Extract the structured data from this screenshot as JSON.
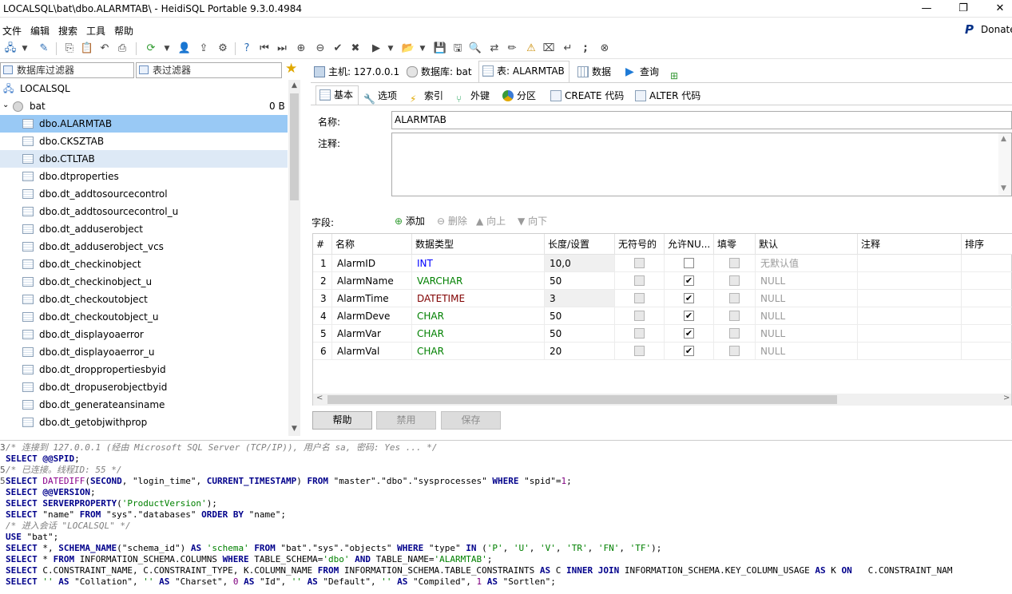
{
  "window": {
    "title": "LOCALSQL\\bat\\dbo.ALARMTAB\\ - HeidiSQL Portable 9.3.0.4984",
    "minimize": "—",
    "maximize": "❐",
    "close": "✕"
  },
  "menu": {
    "items": [
      "文件",
      "编辑",
      "搜索",
      "工具",
      "帮助"
    ],
    "donate": "Donate"
  },
  "filters": {
    "db_filter": "数据库过滤器",
    "table_filter": "表过滤器"
  },
  "tree": {
    "server": "LOCALSQL",
    "database": "bat",
    "db_size": "0 B",
    "tables": [
      "dbo.ALARMTAB",
      "dbo.CKSZTAB",
      "dbo.CTLTAB",
      "dbo.dtproperties",
      "dbo.dt_addtosourcecontrol",
      "dbo.dt_addtosourcecontrol_u",
      "dbo.dt_adduserobject",
      "dbo.dt_adduserobject_vcs",
      "dbo.dt_checkinobject",
      "dbo.dt_checkinobject_u",
      "dbo.dt_checkoutobject",
      "dbo.dt_checkoutobject_u",
      "dbo.dt_displayoaerror",
      "dbo.dt_displayoaerror_u",
      "dbo.dt_droppropertiesbyid",
      "dbo.dt_dropuserobjectbyid",
      "dbo.dt_generateansiname",
      "dbo.dt_getobjwithprop"
    ]
  },
  "tabs": {
    "host": "主机: 127.0.0.1",
    "database": "数据库: bat",
    "table": "表: ALARMTAB",
    "data": "数据",
    "query": "查询"
  },
  "subtabs": {
    "basic": "基本",
    "options": "选项",
    "indexes": "索引",
    "foreign_keys": "外键",
    "partitions": "分区",
    "create_code": "CREATE 代码",
    "alter_code": "ALTER 代码"
  },
  "form": {
    "name_label": "名称:",
    "name_value": "ALARMTAB",
    "comment_label": "注释:",
    "comment_value": ""
  },
  "fields_bar": {
    "label": "字段:",
    "add": "添加",
    "delete": "删除",
    "up": "向上",
    "down": "向下"
  },
  "columns_grid": {
    "headers": [
      "#",
      "名称",
      "数据类型",
      "长度/设置",
      "无符号的",
      "允许NU...",
      "填零",
      "默认",
      "注释",
      "排序"
    ],
    "rows": [
      {
        "num": "1",
        "name": "AlarmID",
        "type": "INT",
        "type_color": "#0000ff",
        "length": "10,0",
        "unsigned": false,
        "allow_null": false,
        "zerofill": false,
        "default": "无默认值"
      },
      {
        "num": "2",
        "name": "AlarmName",
        "type": "VARCHAR",
        "type_color": "#008000",
        "length": "50",
        "unsigned": false,
        "allow_null": true,
        "zerofill": false,
        "default": "NULL"
      },
      {
        "num": "3",
        "name": "AlarmTime",
        "type": "DATETIME",
        "type_color": "#800000",
        "length": "3",
        "unsigned": false,
        "allow_null": true,
        "zerofill": false,
        "default": "NULL"
      },
      {
        "num": "4",
        "name": "AlarmDeve",
        "type": "CHAR",
        "type_color": "#008000",
        "length": "50",
        "unsigned": false,
        "allow_null": true,
        "zerofill": false,
        "default": "NULL"
      },
      {
        "num": "5",
        "name": "AlarmVar",
        "type": "CHAR",
        "type_color": "#008000",
        "length": "50",
        "unsigned": false,
        "allow_null": true,
        "zerofill": false,
        "default": "NULL"
      },
      {
        "num": "6",
        "name": "AlarmVal",
        "type": "CHAR",
        "type_color": "#008000",
        "length": "20",
        "unsigned": false,
        "allow_null": true,
        "zerofill": false,
        "default": "NULL"
      }
    ]
  },
  "buttons": {
    "help": "帮助",
    "discard": "禁用",
    "save": "保存"
  },
  "sql_log": [
    {
      "n": "3",
      "parts": [
        [
          "cm",
          "/* 连接到 127.0.0.1 (经由 Microsoft SQL Server (TCP/IP)), 用户名 sa, 密码: Yes ... */"
        ]
      ]
    },
    {
      "n": "",
      "parts": [
        [
          "kw",
          "SELECT"
        ],
        [
          "",
          " "
        ],
        [
          "kw",
          "@@SPID"
        ],
        [
          "",
          ";"
        ]
      ]
    },
    {
      "n": "5",
      "parts": [
        [
          "cm",
          "/* 已连接。线程ID: 55 */"
        ]
      ]
    },
    {
      "n": "5",
      "parts": [
        [
          "kw",
          "SELECT"
        ],
        [
          "",
          " "
        ],
        [
          "fn",
          "DATEDIFF"
        ],
        [
          "",
          "("
        ],
        [
          "kw",
          "SECOND"
        ],
        [
          "",
          ", \"login_time\", "
        ],
        [
          "kw",
          "CURRENT_TIMESTAMP"
        ],
        [
          "",
          ") "
        ],
        [
          "kw",
          "FROM"
        ],
        [
          "",
          " \"master\".\"dbo\".\"sysprocesses\" "
        ],
        [
          "kw",
          "WHERE"
        ],
        [
          "",
          " \"spid\"="
        ],
        [
          "nu",
          "1"
        ],
        [
          "",
          ";"
        ]
      ]
    },
    {
      "n": "",
      "parts": [
        [
          "kw",
          "SELECT"
        ],
        [
          "",
          " "
        ],
        [
          "kw",
          "@@VERSION"
        ],
        [
          "",
          ";"
        ]
      ]
    },
    {
      "n": "",
      "parts": [
        [
          "kw",
          "SELECT"
        ],
        [
          "",
          " "
        ],
        [
          "kw",
          "SERVERPROPERTY"
        ],
        [
          "",
          "("
        ],
        [
          "st",
          "'ProductVersion'"
        ],
        [
          "",
          ");"
        ]
      ]
    },
    {
      "n": "",
      "parts": [
        [
          "kw",
          "SELECT"
        ],
        [
          "",
          " \"name\" "
        ],
        [
          "kw",
          "FROM"
        ],
        [
          "",
          " \"sys\".\"databases\" "
        ],
        [
          "kw",
          "ORDER BY"
        ],
        [
          "",
          " \"name\";"
        ]
      ]
    },
    {
      "n": "",
      "parts": [
        [
          "cm",
          "/* 进入会话 \"LOCALSQL\" */"
        ]
      ]
    },
    {
      "n": "",
      "parts": [
        [
          "kw",
          "USE"
        ],
        [
          "",
          " \"bat\";"
        ]
      ]
    },
    {
      "n": "",
      "parts": [
        [
          "kw",
          "SELECT"
        ],
        [
          "",
          " *, "
        ],
        [
          "kw",
          "SCHEMA_NAME"
        ],
        [
          "",
          "(\"schema_id\") "
        ],
        [
          "kw",
          "AS"
        ],
        [
          "",
          " "
        ],
        [
          "st",
          "'schema'"
        ],
        [
          "",
          " "
        ],
        [
          "kw",
          "FROM"
        ],
        [
          "",
          " \"bat\".\"sys\".\"objects\" "
        ],
        [
          "kw",
          "WHERE"
        ],
        [
          "",
          " \"type\" "
        ],
        [
          "kw",
          "IN"
        ],
        [
          "",
          " ("
        ],
        [
          "st",
          "'P'"
        ],
        [
          "",
          ", "
        ],
        [
          "st",
          "'U'"
        ],
        [
          "",
          ", "
        ],
        [
          "st",
          "'V'"
        ],
        [
          "",
          ", "
        ],
        [
          "st",
          "'TR'"
        ],
        [
          "",
          ", "
        ],
        [
          "st",
          "'FN'"
        ],
        [
          "",
          ", "
        ],
        [
          "st",
          "'TF'"
        ],
        [
          "",
          ");"
        ]
      ]
    },
    {
      "n": "",
      "parts": [
        [
          "kw",
          "SELECT"
        ],
        [
          "",
          " * "
        ],
        [
          "kw",
          "FROM"
        ],
        [
          "",
          " INFORMATION_SCHEMA.COLUMNS "
        ],
        [
          "kw",
          "WHERE"
        ],
        [
          "",
          " TABLE_SCHEMA="
        ],
        [
          "st",
          "'dbo'"
        ],
        [
          "",
          " "
        ],
        [
          "kw",
          "AND"
        ],
        [
          "",
          " TABLE_NAME="
        ],
        [
          "st",
          "'ALARMTAB'"
        ],
        [
          "",
          ";"
        ]
      ]
    },
    {
      "n": "",
      "parts": [
        [
          "kw",
          "SELECT"
        ],
        [
          "",
          " C.CONSTRAINT_NAME, C.CONSTRAINT_TYPE, K.COLUMN_NAME "
        ],
        [
          "kw",
          "FROM"
        ],
        [
          "",
          " INFORMATION_SCHEMA.TABLE_CONSTRAINTS "
        ],
        [
          "kw",
          "AS"
        ],
        [
          "",
          " C "
        ],
        [
          "kw",
          "INNER JOIN"
        ],
        [
          "",
          " INFORMATION_SCHEMA.KEY_COLUMN_USAGE "
        ],
        [
          "kw",
          "AS"
        ],
        [
          "",
          " K "
        ],
        [
          "kw",
          "ON"
        ],
        [
          "",
          "   C.CONSTRAINT_NAM"
        ]
      ]
    },
    {
      "n": "",
      "parts": [
        [
          "kw",
          "SELECT"
        ],
        [
          "",
          " "
        ],
        [
          "st",
          "''"
        ],
        [
          "",
          " "
        ],
        [
          "kw",
          "AS"
        ],
        [
          "",
          " \"Collation\", "
        ],
        [
          "st",
          "''"
        ],
        [
          "",
          " "
        ],
        [
          "kw",
          "AS"
        ],
        [
          "",
          " \"Charset\", "
        ],
        [
          "nu",
          "0"
        ],
        [
          "",
          " "
        ],
        [
          "kw",
          "AS"
        ],
        [
          "",
          " \"Id\", "
        ],
        [
          "st",
          "''"
        ],
        [
          "",
          " "
        ],
        [
          "kw",
          "AS"
        ],
        [
          "",
          " \"Default\", "
        ],
        [
          "st",
          "''"
        ],
        [
          "",
          " "
        ],
        [
          "kw",
          "AS"
        ],
        [
          "",
          " \"Compiled\", "
        ],
        [
          "nu",
          "1"
        ],
        [
          "",
          " "
        ],
        [
          "kw",
          "AS"
        ],
        [
          "",
          " \"Sortlen\";"
        ]
      ]
    }
  ]
}
